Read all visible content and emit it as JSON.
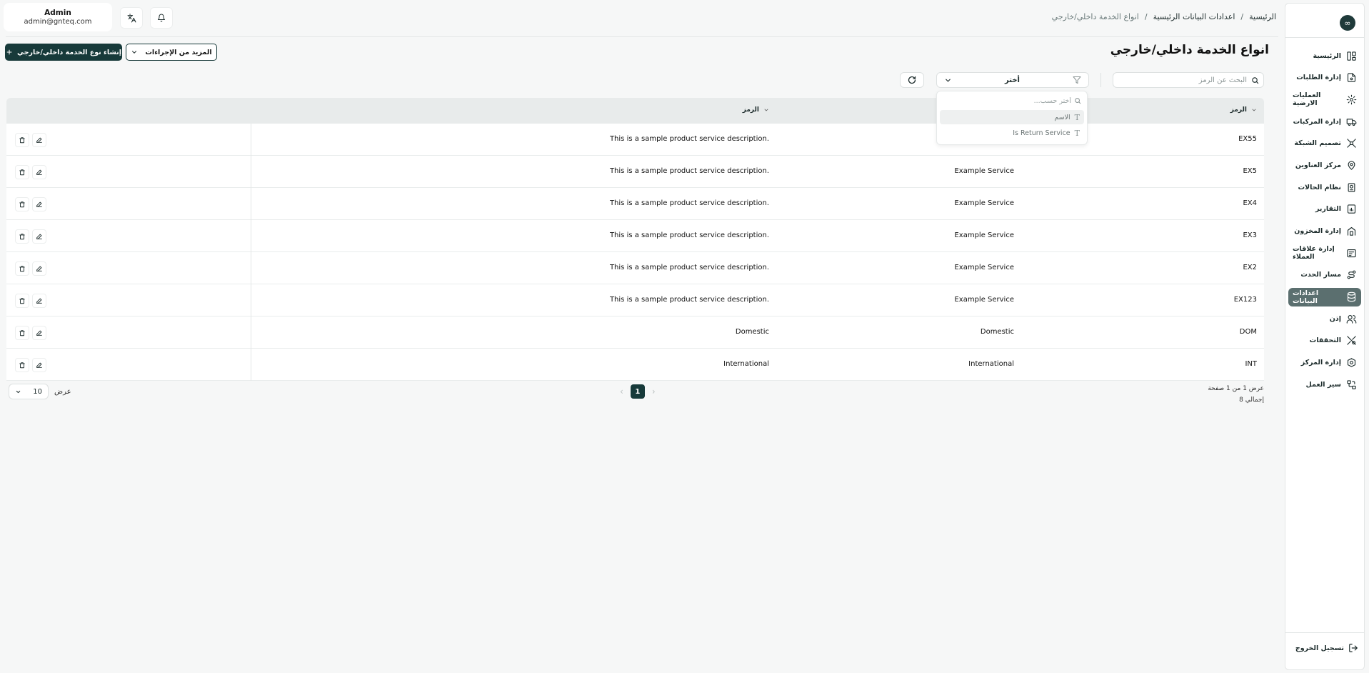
{
  "app": {
    "logo_glyph": "∞"
  },
  "sidebar": {
    "items": [
      {
        "label": "الرئيسية",
        "icon": "dashboard-icon",
        "active": false
      },
      {
        "label": "إدارة الطلبات",
        "icon": "orders-icon",
        "active": false
      },
      {
        "label": "العمليات الارضية",
        "icon": "ground-ops-icon",
        "active": false
      },
      {
        "label": "إدارة المركبات",
        "icon": "truck-icon",
        "active": false
      },
      {
        "label": "تصميم الشبكة",
        "icon": "network-icon",
        "active": false
      },
      {
        "label": "مركز العناوين",
        "icon": "location-icon",
        "active": false
      },
      {
        "label": "نظام الحالات",
        "icon": "status-icon",
        "active": false
      },
      {
        "label": "التقارير",
        "icon": "reports-icon",
        "active": false
      },
      {
        "label": "إدارة المخزون",
        "icon": "inventory-icon",
        "active": false
      },
      {
        "label": "إدارة علاقات العملاء",
        "icon": "crm-icon",
        "active": false
      },
      {
        "label": "مسار الحدث",
        "icon": "route-icon",
        "active": false
      },
      {
        "label": "اعدادات البيانات",
        "icon": "database-icon",
        "active": true
      },
      {
        "label": "إذن",
        "icon": "users-icon",
        "active": false
      },
      {
        "label": "التحققات",
        "icon": "validation-icon",
        "active": false
      },
      {
        "label": "إدارة المركز",
        "icon": "hub-icon",
        "active": false
      },
      {
        "label": "سير العمل",
        "icon": "workflow-icon",
        "active": false
      }
    ],
    "logout_label": "تسجيل الخروج"
  },
  "breadcrumb": {
    "home": "الرئيسية",
    "parent": "اعدادات البيانات الرئيسية",
    "current": "انواع الخدمة داخلي/خارجي",
    "separator": "/"
  },
  "user": {
    "name": "Admin",
    "email": "admin@gnteq.com"
  },
  "page": {
    "title": "انواع الخدمة داخلي/خارجي",
    "create_button": "إنشاء نوع الخدمة داخلي/خارجي",
    "more_actions_button": "المزيد من الإجراءات"
  },
  "filters": {
    "search_placeholder": "البحث عن الرمز",
    "select_value": "أختر",
    "dropdown": {
      "search_placeholder": "أختر حسب...",
      "options": [
        {
          "label": "الاسم",
          "highlighted": true
        },
        {
          "label": "Is Return Service",
          "highlighted": false
        }
      ]
    }
  },
  "table": {
    "headers": {
      "code": "الرمز",
      "name": "الرمز",
      "desc": "الرمز"
    },
    "rows": [
      {
        "code": "EX55",
        "name": "",
        "desc": "This is a sample product service description."
      },
      {
        "code": "EX5",
        "name": "Example Service",
        "desc": "This is a sample product service description."
      },
      {
        "code": "EX4",
        "name": "Example Service",
        "desc": "This is a sample product service description."
      },
      {
        "code": "EX3",
        "name": "Example Service",
        "desc": "This is a sample product service description."
      },
      {
        "code": "EX2",
        "name": "Example Service",
        "desc": "This is a sample product service description."
      },
      {
        "code": "EX123",
        "name": "Example Service",
        "desc": "This is a sample product service description."
      },
      {
        "code": "DOM",
        "name": "Domestic",
        "desc": "Domestic"
      },
      {
        "code": "INT",
        "name": "International",
        "desc": "International"
      }
    ]
  },
  "pagination": {
    "showing_text": "عرض 1 من 1 صفحة",
    "total_text": "إجمالي 8",
    "current_page": "1",
    "page_size": "10",
    "page_size_label": "عرض"
  }
}
